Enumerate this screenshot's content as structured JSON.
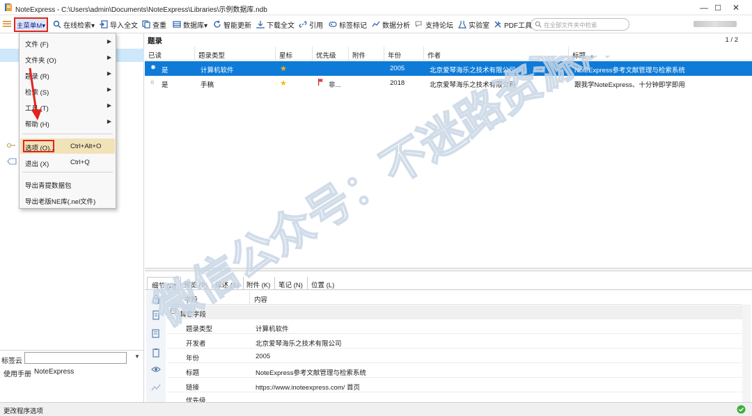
{
  "window": {
    "title": "NoteExpress - C:\\Users\\admin\\Documents\\NoteExpress\\Libraries\\示例数据库.ndb",
    "minimize": "—",
    "maximize": "☐",
    "close": "✕"
  },
  "toolbar": {
    "main_menu": "主菜单M▾",
    "online_search": "在线检索▾",
    "import_fulltext": "导入全文",
    "dedupe": "查重",
    "database": "数据库▾",
    "smart_update": "智能更新",
    "download_fulltext": "下载全文",
    "cite": "引用",
    "tag_mark": "标签标记",
    "data_analysis": "数据分析",
    "forum": "支持论坛",
    "lab": "实验室",
    "pdf_tools": "PDF工具",
    "search_placeholder": "在全部文件夹中检索"
  },
  "menu": {
    "items": [
      {
        "label": "文件 (F)",
        "shortcut": ""
      },
      {
        "label": "文件夹 (O)",
        "shortcut": ""
      },
      {
        "label": "题录 (R)",
        "shortcut": ""
      },
      {
        "label": "检索 (S)",
        "shortcut": ""
      },
      {
        "label": "工具 (T)",
        "shortcut": ""
      },
      {
        "label": "帮助 (H)",
        "shortcut": ""
      },
      {
        "label": "选项 (O)...",
        "shortcut": "Ctrl+Alt+O"
      },
      {
        "label": "退出 (X)",
        "shortcut": "Ctrl+Q"
      },
      {
        "label": "导出青提数据包",
        "shortcut": ""
      },
      {
        "label": "导出老版NE库(.nel文件)",
        "shortcut": ""
      }
    ],
    "submenu_arrow": "▶"
  },
  "records": {
    "title": "题录",
    "page": "1 / 2",
    "columns": [
      "已读",
      "题录类型",
      "星标",
      "优先级",
      "附件",
      "年份",
      "作者",
      "标题"
    ],
    "sort_indicator": "▲",
    "rows": [
      {
        "read": "是",
        "type": "计算机软件",
        "star": "★",
        "priority": "",
        "attachment": "",
        "year": "2005",
        "author": "北京爱琴海乐之技术有限公司",
        "title": "NoteExpress参考文献管理与检索系统",
        "selected": true
      },
      {
        "read": "是",
        "type": "手稿",
        "star": "★",
        "priority": "非...",
        "attachment": "",
        "year": "2018",
        "author": "北京爱琴海乐之技术有限公司",
        "title": "跟我学NoteExpress、十分钟即学即用",
        "selected": false
      }
    ]
  },
  "detail": {
    "tabs": [
      "细节 (D)",
      "预览 (P)",
      "综述 (S)",
      "附件 (K)",
      "笔记 (N)",
      "位置 (L)"
    ],
    "head_field": "字段",
    "head_content": "内容",
    "group": "其它字段",
    "rows": [
      {
        "key": "题录类型",
        "value": "计算机软件"
      },
      {
        "key": "开发者",
        "value": "北京爱琴海乐之技术有限公司"
      },
      {
        "key": "年份",
        "value": "2005"
      },
      {
        "key": "标题",
        "value": "NoteExpress参考文献管理与检索系统"
      },
      {
        "key": "链接",
        "value": "https://www.inoteexpress.com/ 首页"
      },
      {
        "key": "优先级",
        "value": ""
      }
    ]
  },
  "left": {
    "tagcloud_label": "标签云",
    "tags": [
      "使用手册",
      "NoteExpress"
    ]
  },
  "status": {
    "text": "更改程序选项"
  },
  "watermark": "微信公众号：不迷路资源库",
  "colors": {
    "selection": "#0e7bd8",
    "annotation_red": "#e2241b",
    "menu_hover": "#f2e2b8",
    "star": "#f3b90e"
  }
}
